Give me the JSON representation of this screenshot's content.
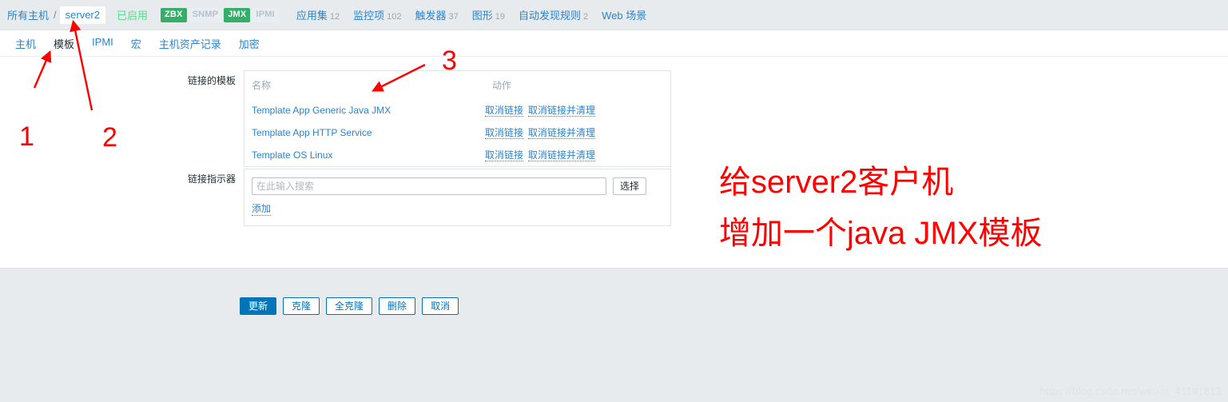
{
  "header": {
    "breadcrumb_root": "所有主机",
    "breadcrumb_separator": "/",
    "breadcrumb_current": "server2",
    "status": "已启用",
    "badges": [
      {
        "label": "ZBX",
        "state": "on"
      },
      {
        "label": "SNMP",
        "state": "off"
      },
      {
        "label": "JMX",
        "state": "on"
      },
      {
        "label": "IPMI",
        "state": "off"
      }
    ],
    "links": [
      {
        "label": "应用集",
        "count": "12"
      },
      {
        "label": "监控项",
        "count": "102"
      },
      {
        "label": "触发器",
        "count": "37"
      },
      {
        "label": "图形",
        "count": "19"
      },
      {
        "label": "自动发现规则",
        "count": "2"
      },
      {
        "label": "Web 场景",
        "count": ""
      }
    ]
  },
  "tabs": [
    {
      "label": "主机",
      "active": false
    },
    {
      "label": "模板",
      "active": true
    },
    {
      "label": "IPMI",
      "active": false
    },
    {
      "label": "宏",
      "active": false
    },
    {
      "label": "主机资产记录",
      "active": false
    },
    {
      "label": "加密",
      "active": false
    }
  ],
  "form": {
    "linked_templates": {
      "label": "链接的模板",
      "columns": [
        "名称",
        "动作"
      ],
      "rows": [
        {
          "name": "Template App Generic Java JMX",
          "unlink": "取消链接",
          "unlink_clear": "取消链接并清理"
        },
        {
          "name": "Template App HTTP Service",
          "unlink": "取消链接",
          "unlink_clear": "取消链接并清理"
        },
        {
          "name": "Template OS Linux",
          "unlink": "取消链接",
          "unlink_clear": "取消链接并清理"
        }
      ]
    },
    "link_indicator": {
      "label": "链接指示器",
      "search_value": "",
      "search_placeholder": "在此输入搜索",
      "select_button": "选择",
      "add_link": "添加"
    },
    "buttons": [
      {
        "label": "更新",
        "primary": true
      },
      {
        "label": "克隆",
        "primary": false
      },
      {
        "label": "全克隆",
        "primary": false
      },
      {
        "label": "删除",
        "primary": false
      },
      {
        "label": "取消",
        "primary": false
      }
    ]
  },
  "annotations": {
    "marker_1": "1",
    "marker_2": "2",
    "marker_3": "3",
    "note_line_1": "给server2客户机",
    "note_line_2": "增加一个java JMX模板",
    "color": "#ff0000"
  },
  "watermark": "https://blog.csdn.net/weixin_41191813"
}
